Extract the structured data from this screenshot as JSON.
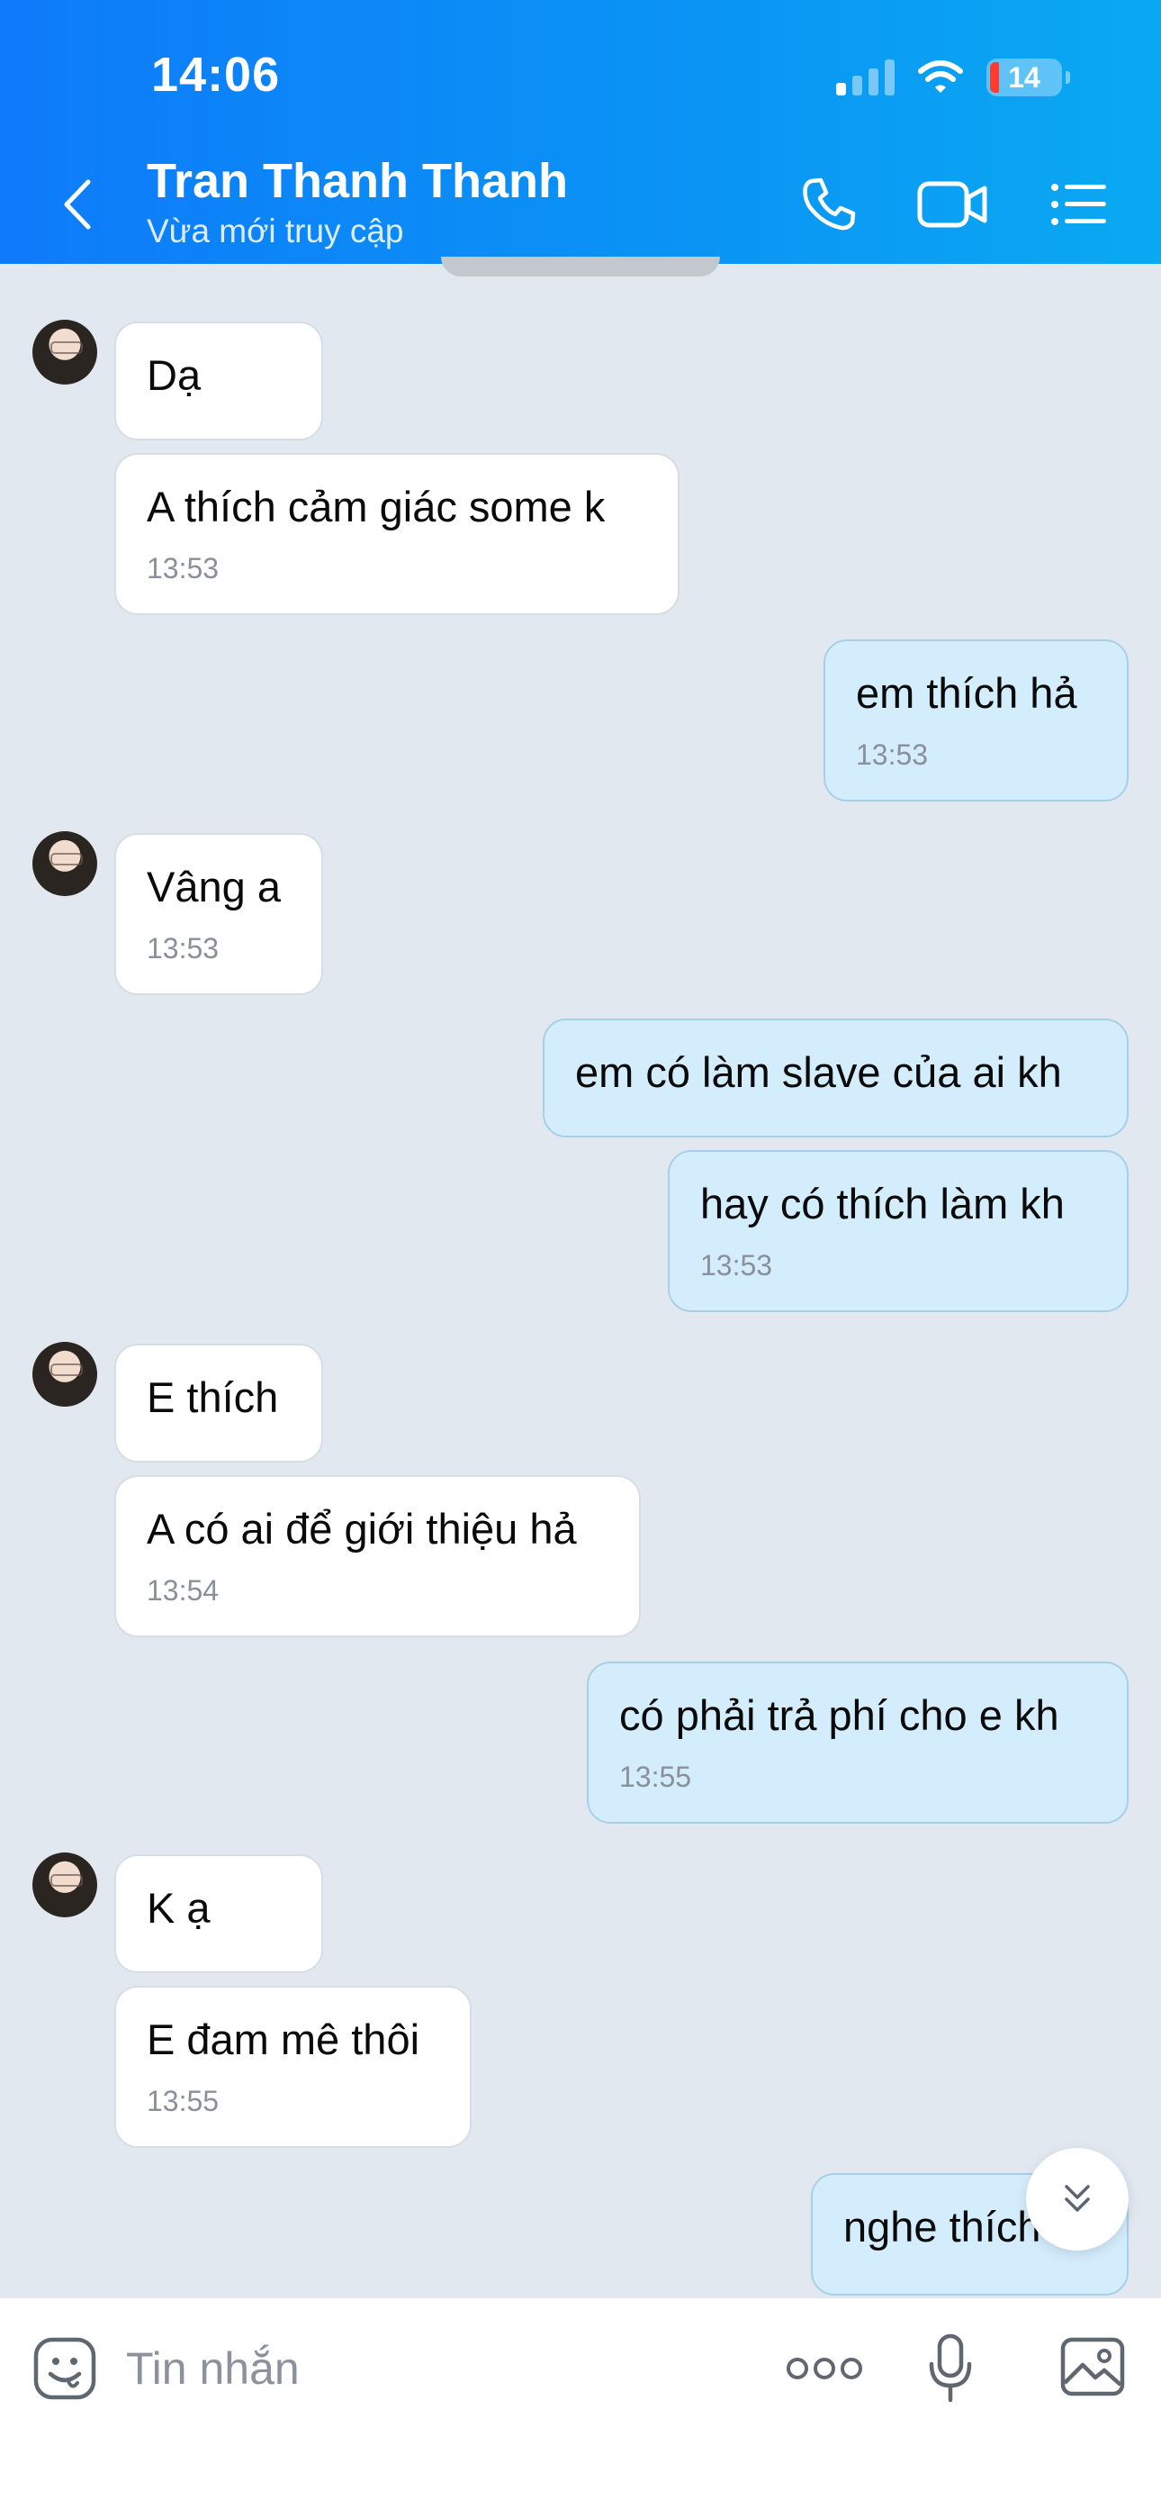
{
  "status_bar": {
    "time": "14:06",
    "battery_level": "14"
  },
  "header": {
    "contact_name": "Tran Thanh Thanh",
    "contact_status": "Vừa mới truy cập",
    "icons": [
      "back-icon",
      "phone-icon",
      "video-icon",
      "list-menu-icon"
    ]
  },
  "messages": [
    {
      "side": "in",
      "text": "Dạ",
      "time": ""
    },
    {
      "side": "in",
      "text": "A thích cảm giác some k",
      "time": "13:53"
    },
    {
      "side": "out",
      "text": "em thích hả",
      "time": "13:53"
    },
    {
      "side": "in",
      "text": "Vâng a",
      "time": "13:53"
    },
    {
      "side": "out",
      "text": "em có làm slave của ai kh",
      "time": ""
    },
    {
      "side": "out",
      "text": "hay có thích làm kh",
      "time": "13:53"
    },
    {
      "side": "in",
      "text": "E thích",
      "time": ""
    },
    {
      "side": "in",
      "text": "A có ai để giới thiệu hả",
      "time": "13:54"
    },
    {
      "side": "out",
      "text": "có phải trả phí cho e kh",
      "time": "13:55"
    },
    {
      "side": "in",
      "text": "K ạ",
      "time": ""
    },
    {
      "side": "in",
      "text": "E đam mê thôi",
      "time": "13:55"
    },
    {
      "side": "out",
      "text": "nghe thích",
      "time": ""
    }
  ],
  "composer": {
    "placeholder": "Tin nhắn",
    "icons": [
      "sticker-icon",
      "more-icon",
      "microphone-icon",
      "image-icon"
    ]
  },
  "colors": {
    "header_start": "#0e7bfa",
    "header_end": "#0aa9f2",
    "chat_background": "#e2e8f0",
    "incoming_bubble": "#ffffff",
    "outgoing_bubble": "#d4edfc",
    "timestamp": "#8a9099"
  }
}
